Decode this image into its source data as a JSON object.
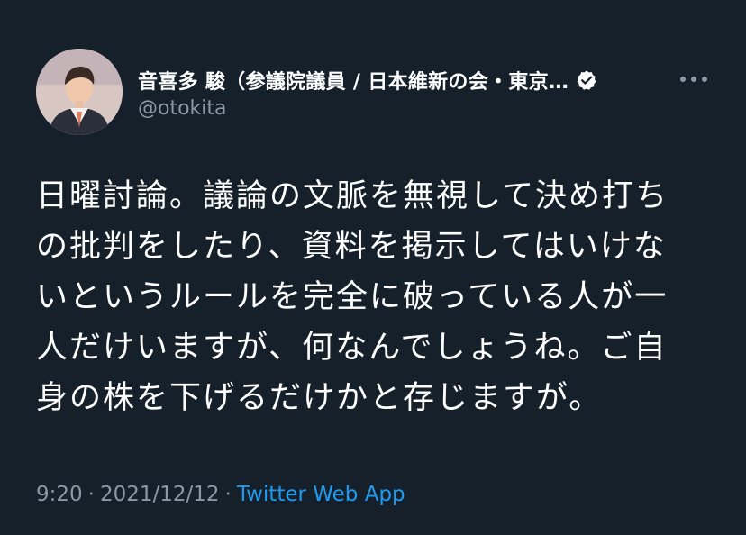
{
  "tweet": {
    "author": {
      "display_name": "音喜多 駿（参議院議員 / 日本維新の会・東京…",
      "handle": "@otokita",
      "verified": true
    },
    "body_lines": [
      "日曜討論。議論の文脈を無視して決め打ち",
      "の批判をしたり、資料を掲示してはいけな",
      "いというルールを完全に破っている人が一",
      "人だけいますが、何なんでしょうね。ご自",
      "身の株を下げるだけかと存じますが。"
    ],
    "meta": {
      "time": "9:20",
      "separator": "·",
      "date": "2021/12/12",
      "source": "Twitter Web App"
    }
  },
  "icons": {
    "verified": "verified-badge-icon",
    "more": "more-options-icon"
  },
  "colors": {
    "background": "#15202b",
    "text": "#ffffff",
    "secondary": "#8b98a5",
    "link": "#1d9bf0"
  }
}
